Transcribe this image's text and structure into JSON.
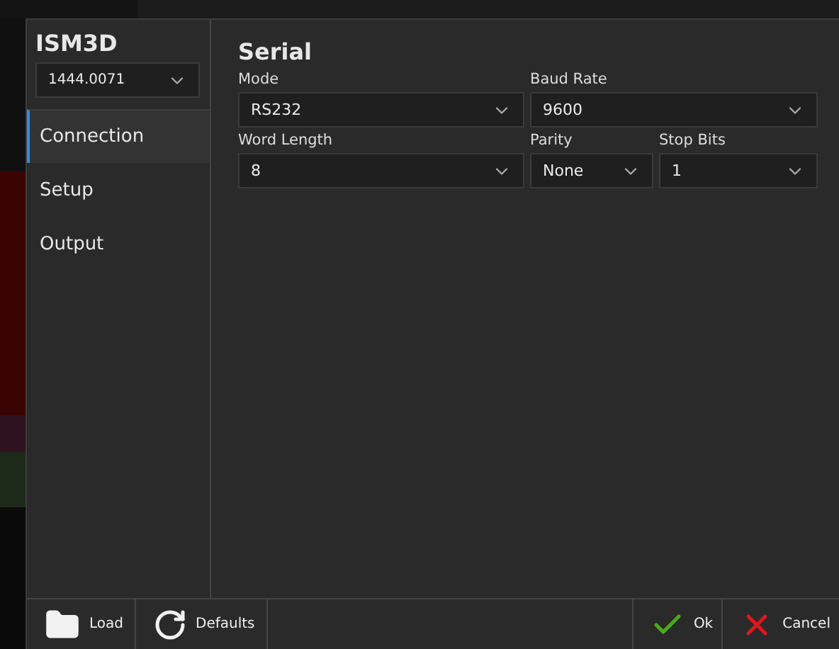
{
  "app": {
    "title": "ISM3D",
    "device": {
      "value": "1444.0071"
    }
  },
  "nav": [
    {
      "label": "Connection",
      "selected": true
    },
    {
      "label": "Setup",
      "selected": false
    },
    {
      "label": "Output",
      "selected": false
    }
  ],
  "section": {
    "title": "Serial",
    "fields": [
      {
        "label": "Mode",
        "value": "RS232"
      },
      {
        "label": "Baud Rate",
        "value": "9600"
      },
      {
        "label": "Word Length",
        "value": "8"
      },
      {
        "label": "Parity",
        "value": "None"
      },
      {
        "label": "Stop Bits",
        "value": "1"
      }
    ]
  },
  "footer": {
    "left": [
      {
        "label": "Load",
        "kind": "load"
      },
      {
        "label": "Defaults",
        "kind": "reset"
      }
    ],
    "right": [
      {
        "label": "Ok",
        "kind": "ok"
      },
      {
        "label": "Cancel",
        "kind": "cancel"
      }
    ]
  }
}
